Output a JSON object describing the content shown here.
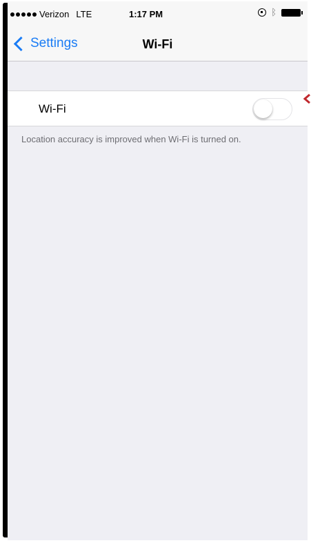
{
  "status_bar": {
    "carrier": "Verizon",
    "network": "LTE",
    "time": "1:17 PM",
    "icons": [
      "signal-dots-icon",
      "orientation-lock-icon",
      "bluetooth-icon",
      "battery-icon"
    ]
  },
  "nav": {
    "back_label": "Settings",
    "title": "Wi-Fi"
  },
  "wifi": {
    "label": "Wi-Fi",
    "enabled": false
  },
  "footnote": "Location accuracy is improved when Wi-Fi is turned on.",
  "colors": {
    "accent": "#1a7cf5",
    "background": "#efeff4",
    "callout": "#c0282d"
  }
}
